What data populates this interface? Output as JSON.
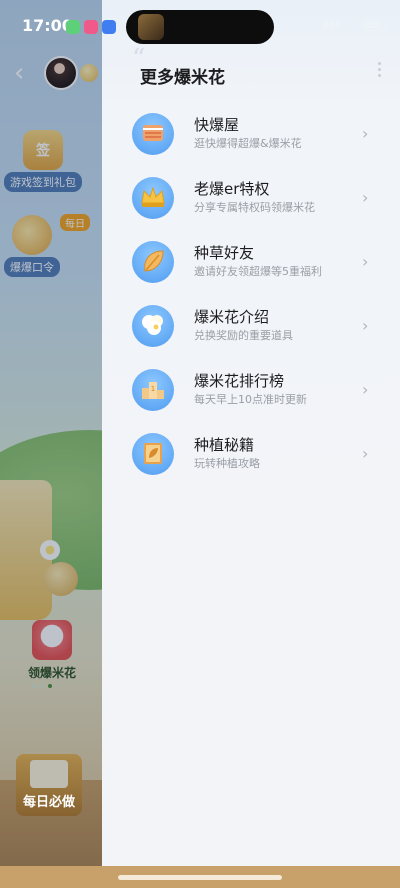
{
  "status_bar": {
    "time": "17:00",
    "app_icon_colors": [
      "#5fd07a",
      "#f05a8a",
      "#3f7df0"
    ],
    "network_speed": "2.00\nKB/s",
    "signal_label": "5G"
  },
  "background_app": {
    "signin_icon_text": "签",
    "signin_label": "游戏签到礼包",
    "code_label": "爆爆口令",
    "code_tag": "每日",
    "popcorn_label": "领爆米花",
    "daily_label": "每日必做"
  },
  "drawer": {
    "title": "更多爆米花",
    "items": [
      {
        "name": "快爆屋",
        "desc": "逛快爆得超爆&爆米花",
        "icon": "house-icon"
      },
      {
        "name": "老爆er特权",
        "desc": "分享专属特权码领爆米花",
        "icon": "crown-icon"
      },
      {
        "name": "种草好友",
        "desc": "邀请好友领超爆等5重福利",
        "icon": "leaf-icon"
      },
      {
        "name": "爆米花介绍",
        "desc": "兑换奖励的重要道具",
        "icon": "popcorn-icon"
      },
      {
        "name": "爆米花排行榜",
        "desc": "每天早上10点准时更新",
        "icon": "podium-icon"
      },
      {
        "name": "种植秘籍",
        "desc": "玩转种植攻略",
        "icon": "book-icon"
      }
    ]
  },
  "colors": {
    "accent_blue": "#4f9cf0",
    "title_text": "#1d1d1f",
    "desc_text": "#9a9ea6"
  }
}
